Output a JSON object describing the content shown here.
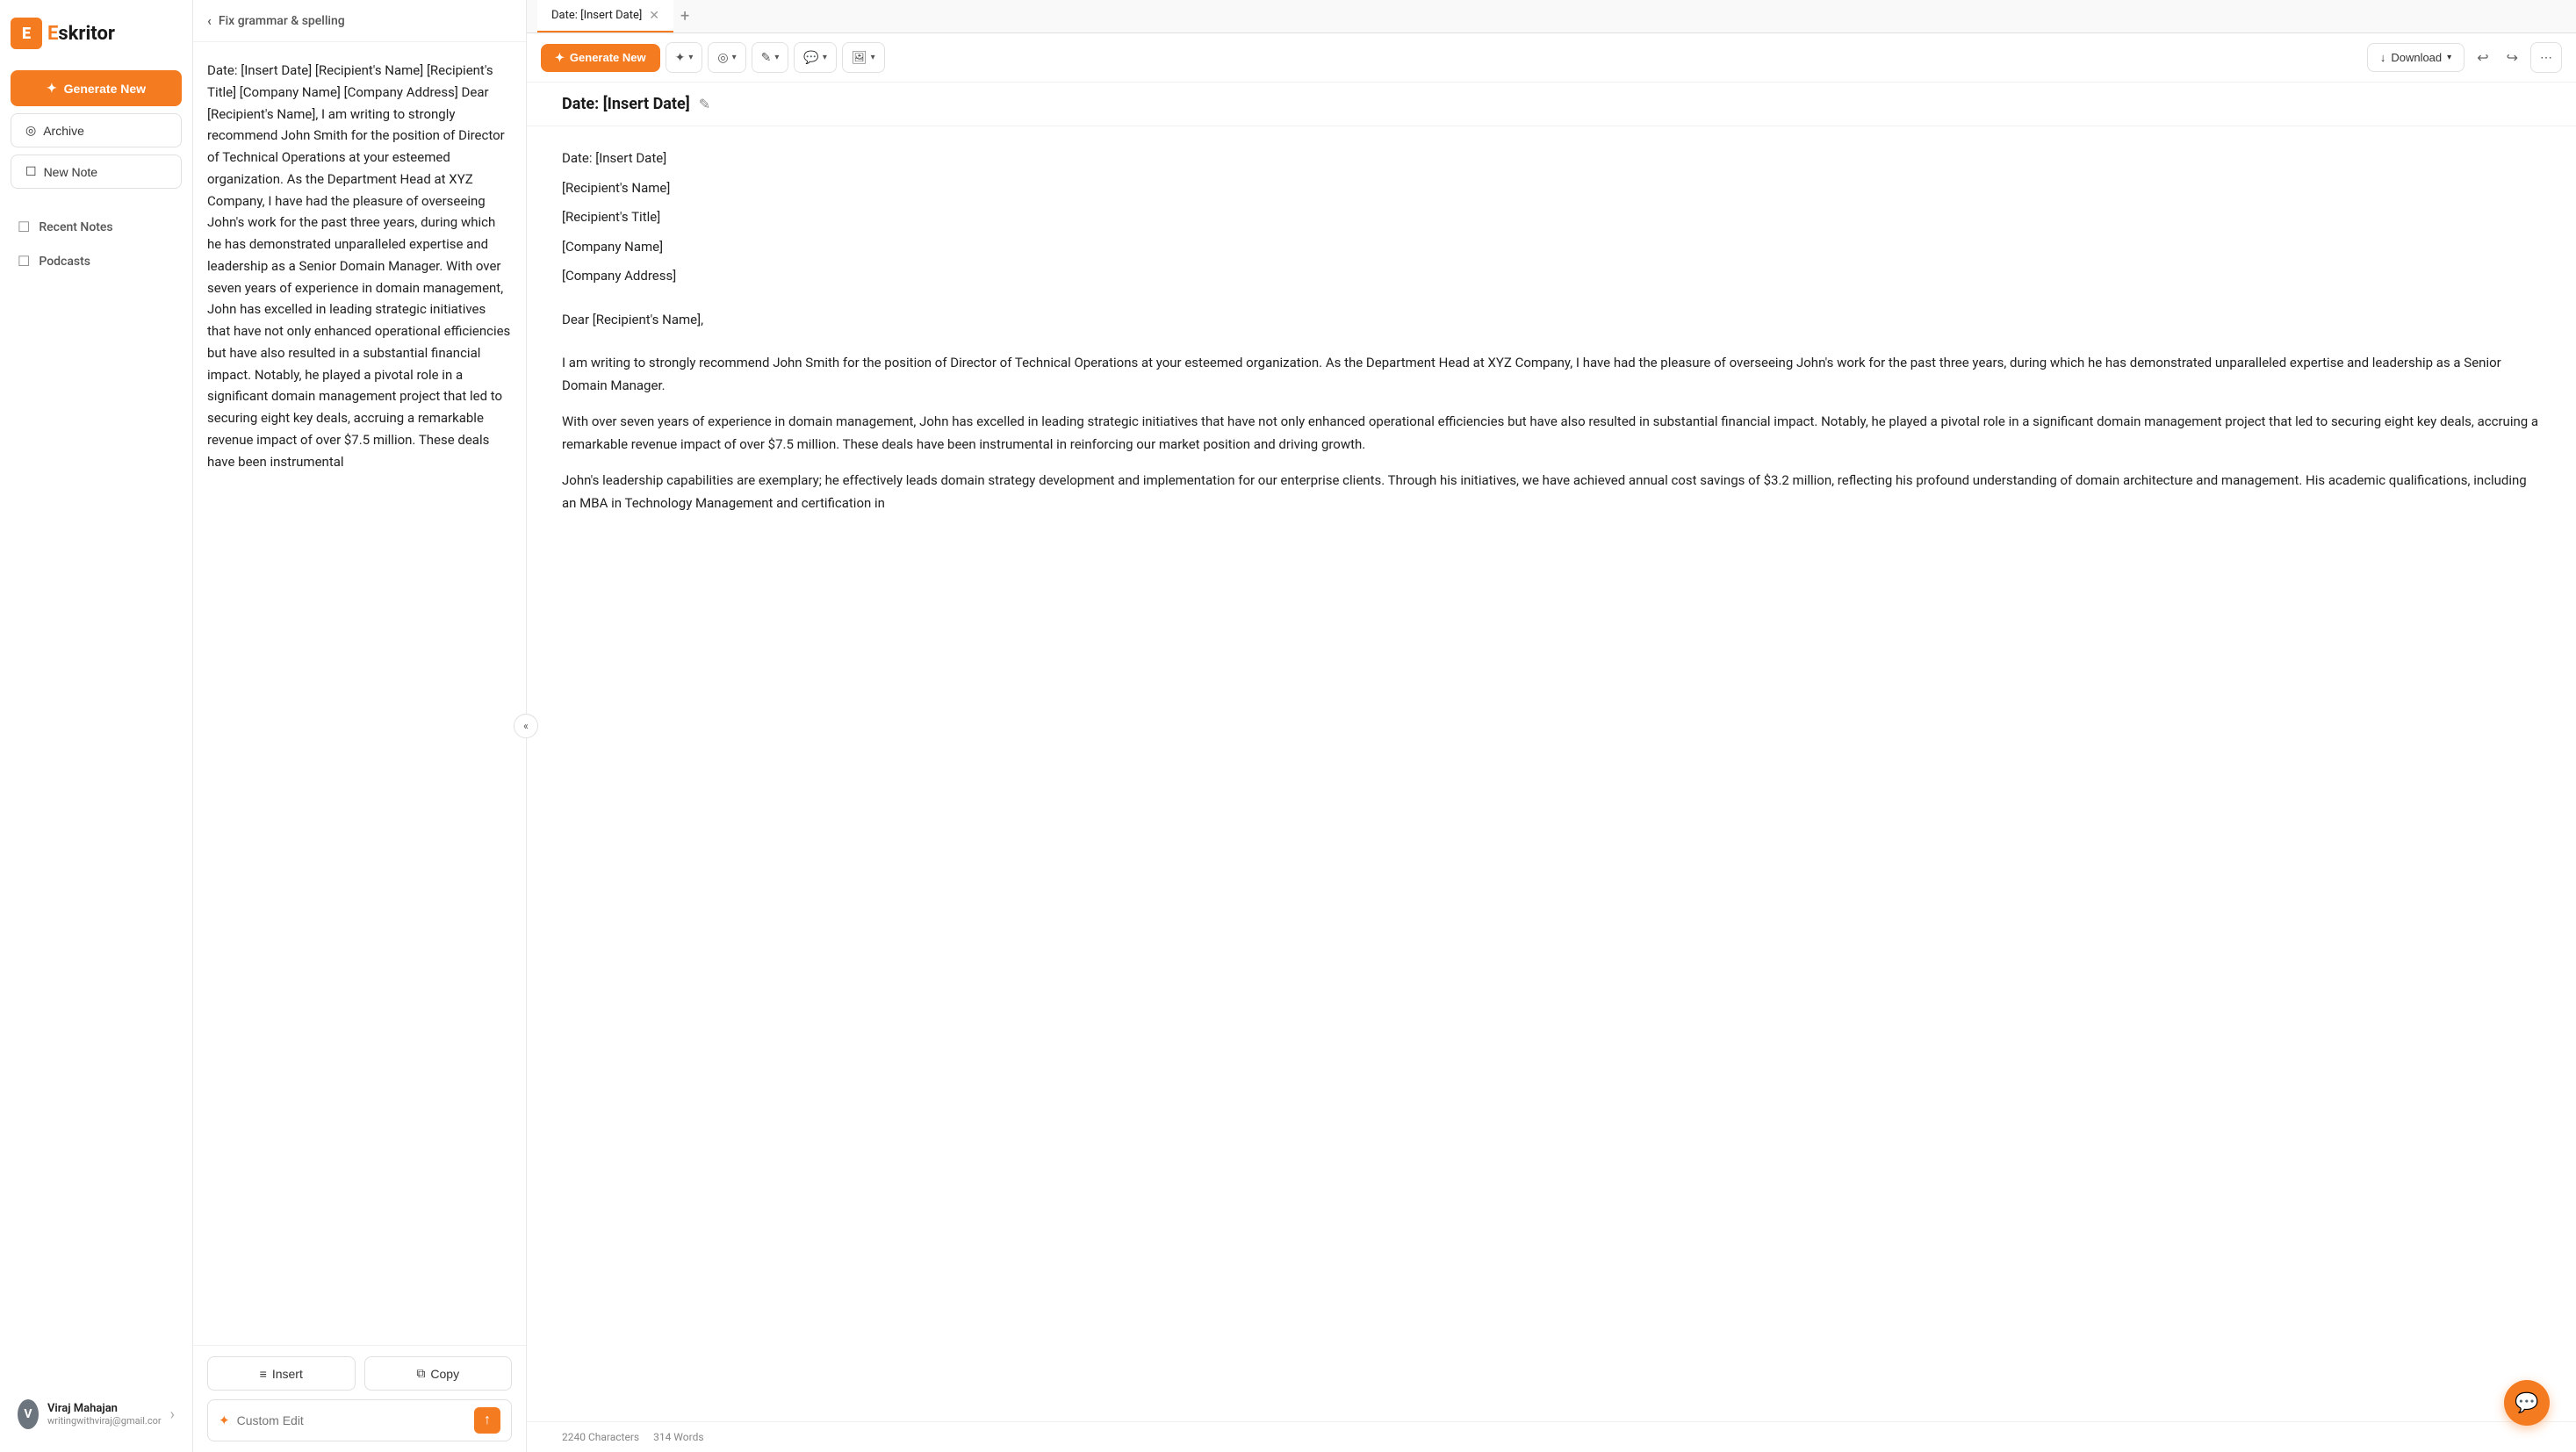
{
  "sidebar": {
    "logo_letter": "E",
    "logo_name_prefix": "E",
    "logo_name_suffix": "skritor",
    "generate_btn": "Generate New",
    "archive_btn": "Archive",
    "new_note_btn": "New Note",
    "recent_notes_label": "Recent Notes",
    "podcasts_label": "Podcasts",
    "user": {
      "avatar": "V",
      "name": "Viraj Mahajan",
      "email": "writingwithviraj@gmail.cor",
      "chevron": "›"
    }
  },
  "middle_panel": {
    "breadcrumb": "Fix grammar & spelling",
    "content": "Date: [Insert Date] [Recipient's Name] [Recipient's Title] [Company Name] [Company Address] Dear [Recipient's Name], I am writing to strongly recommend John Smith for the position of Director of Technical Operations at your esteemed organization. As the Department Head at XYZ Company, I have had the pleasure of overseeing John's work for the past three years, during which he has demonstrated unparalleled expertise and leadership as a Senior Domain Manager. With over seven years of experience in domain management, John has excelled in leading strategic initiatives that have not only enhanced operational efficiencies but have also resulted in a substantial financial impact. Notably, he played a pivotal role in a significant domain management project that led to securing eight key deals, accruing a remarkable revenue impact of over $7.5 million. These deals have been instrumental",
    "insert_btn": "Insert",
    "copy_btn": "Copy",
    "custom_edit_placeholder": "Custom Edit",
    "custom_edit_icon": "✦"
  },
  "editor": {
    "tab_label": "Date: [Insert Date]",
    "title": "Date: [Insert Date]",
    "toolbar": {
      "generate_btn": "Generate New",
      "download_btn": "Download"
    },
    "lines": [
      "Date: [Insert Date]",
      "[Recipient's Name]",
      "[Recipient's Title]",
      "[Company Name]",
      "[Company Address]",
      "Dear [Recipient's Name],",
      "I am writing to strongly recommend John Smith for the position of Director of Technical Operations at your esteemed organization. As the Department Head at XYZ Company, I have had the pleasure of overseeing John's work for the past three years, during which he has demonstrated unparalleled expertise and leadership as a Senior Domain Manager.",
      "With over seven years of experience in domain management, John has excelled in leading strategic initiatives that have not only enhanced operational efficiencies but have also resulted in substantial financial impact. Notably, he played a pivotal role in a significant domain management project that led to securing eight key deals, accruing a remarkable revenue impact of over $7.5 million. These deals have been instrumental in reinforcing our market position and driving growth.",
      "John's leadership capabilities are exemplary; he effectively leads domain strategy development and implementation for our enterprise clients. Through his initiatives, we have achieved annual cost savings of $3.2 million, reflecting his profound understanding of domain architecture and management. His academic qualifications, including an MBA in Technology Management and certification in"
    ],
    "footer": {
      "characters": "2240 Characters",
      "words": "314 Words"
    }
  }
}
